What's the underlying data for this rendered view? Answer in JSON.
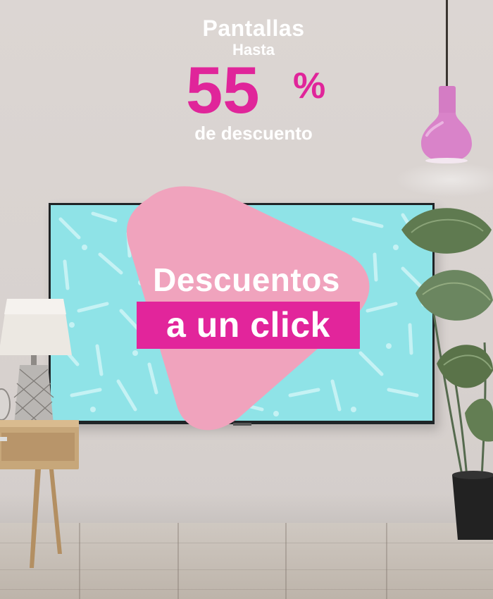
{
  "headline": {
    "category": "Pantallas",
    "prefix": "Hasta",
    "discount_number": "55",
    "discount_symbol": "%",
    "suffix": "de descuento"
  },
  "promo": {
    "line1": "Descuentos",
    "line2": "a un click"
  },
  "colors": {
    "accent_pink": "#e2259b",
    "soft_pink": "#f0a3bd",
    "screen_cyan": "#8fe3e7",
    "wall": "#dcd6d3"
  },
  "icons": {
    "pendant_lamp": "pendant-lamp-icon",
    "table_lamp": "table-lamp-icon",
    "plant": "monstera-plant-icon"
  }
}
